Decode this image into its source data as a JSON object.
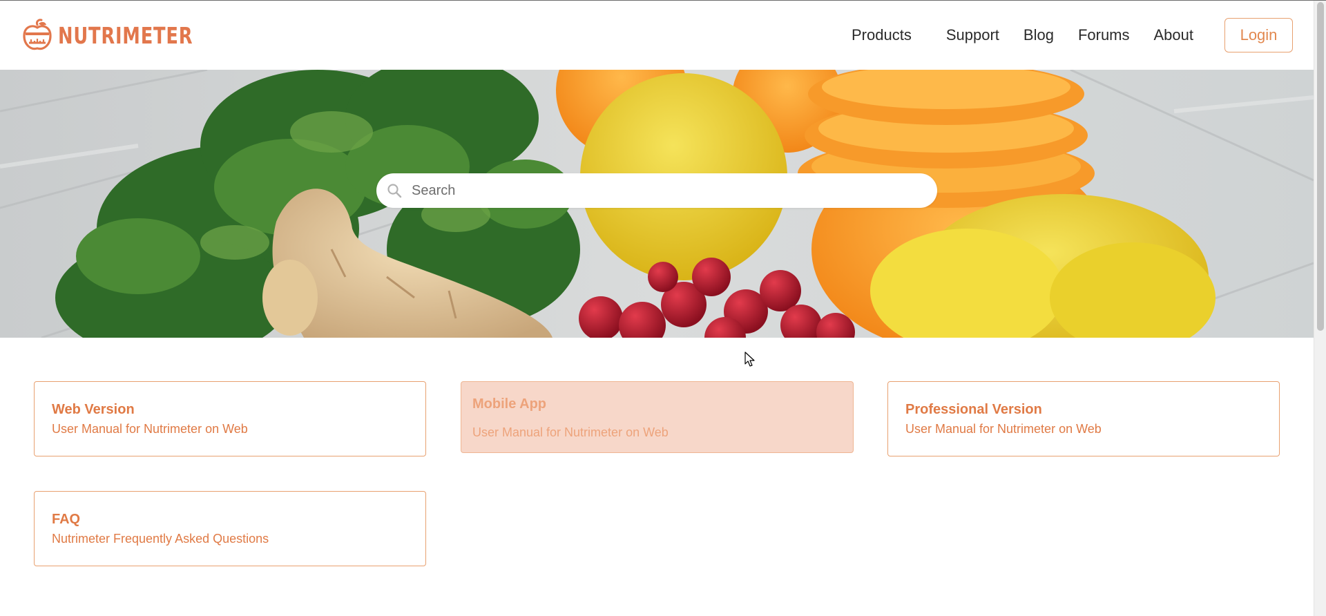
{
  "brand": {
    "name": "NUTRIMETER",
    "color": "#e2774c"
  },
  "nav": {
    "items": [
      {
        "label": "Products"
      },
      {
        "label": "Support"
      },
      {
        "label": "Blog"
      },
      {
        "label": "Forums"
      },
      {
        "label": "About"
      }
    ],
    "login_label": "Login"
  },
  "hero": {
    "search_placeholder": "Search",
    "search_value": ""
  },
  "cards": [
    {
      "title": "Web Version",
      "subtitle": "User Manual for Nutrimeter on Web"
    },
    {
      "title": "Mobile App",
      "subtitle": "User Manual for Nutrimeter on Web",
      "state": "hovered"
    },
    {
      "title": "Professional Version",
      "subtitle": "User Manual for Nutrimeter on Web"
    },
    {
      "title": "FAQ",
      "subtitle": "Nutrimeter Frequently Asked Questions"
    }
  ],
  "colors": {
    "accent": "#e07a45",
    "card_border": "#e8a06f",
    "card_hover_bg": "#f7d7c9"
  },
  "icons": {
    "logo": "apple-scale-icon",
    "search": "search-icon",
    "cursor": "mouse-pointer-icon"
  }
}
